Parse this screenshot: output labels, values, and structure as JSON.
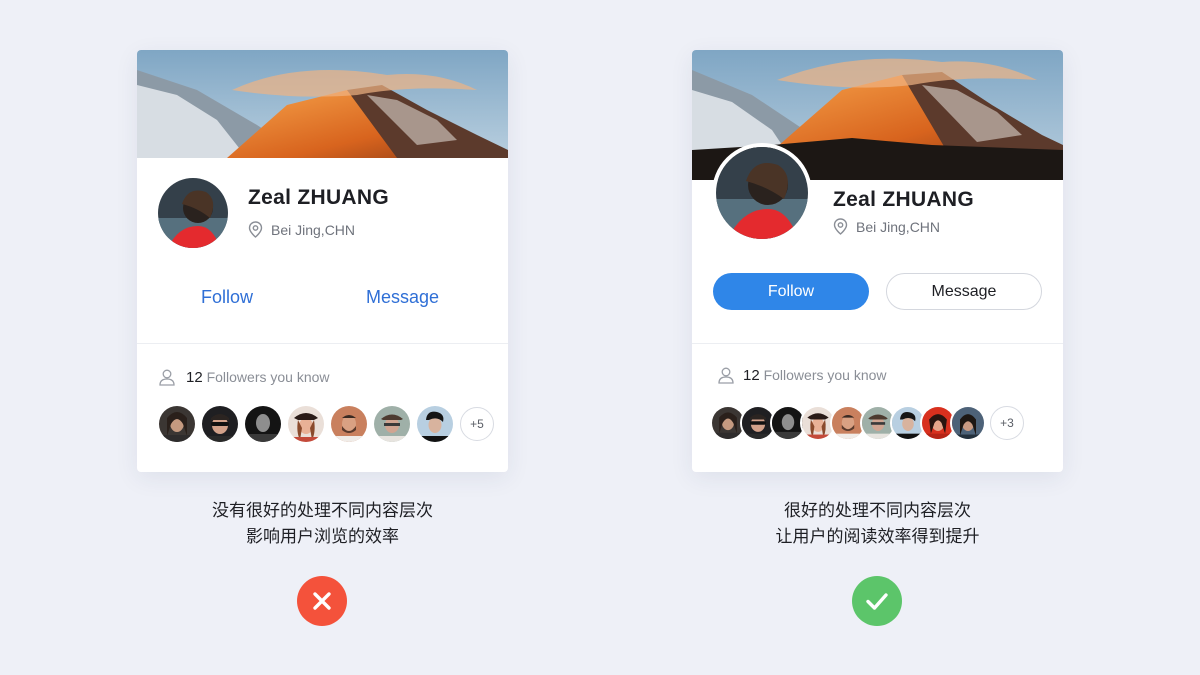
{
  "colors": {
    "background": "#eef0f7",
    "link_blue": "#2f6fd6",
    "primary_button": "#2f86e8",
    "bad_mark": "#f4523b",
    "good_mark": "#5cc56a"
  },
  "bad_example": {
    "profile": {
      "name": "Zeal ZHUANG",
      "location": "Bei Jing,CHN",
      "location_icon": "location-pin-icon"
    },
    "actions": {
      "follow_label": "Follow",
      "message_label": "Message"
    },
    "followers": {
      "count": "12",
      "text": "Followers you know",
      "icon": "user-outline-icon",
      "more_label": "+5",
      "avatar_count": 7
    },
    "caption": {
      "line1": "没有很好的处理不同内容层次",
      "line2": "影响用户浏览的效率"
    },
    "verdict_icon": "cross-icon"
  },
  "good_example": {
    "profile": {
      "name": "Zeal ZHUANG",
      "location": "Bei Jing,CHN",
      "location_icon": "location-pin-icon"
    },
    "actions": {
      "follow_label": "Follow",
      "message_label": "Message"
    },
    "followers": {
      "count": "12",
      "text": "Followers you know",
      "icon": "user-outline-icon",
      "more_label": "+3",
      "avatar_count": 9
    },
    "caption": {
      "line1": "很好的处理不同内容层次",
      "line2": "让用户的阅读效率得到提升"
    },
    "verdict_icon": "check-icon"
  }
}
